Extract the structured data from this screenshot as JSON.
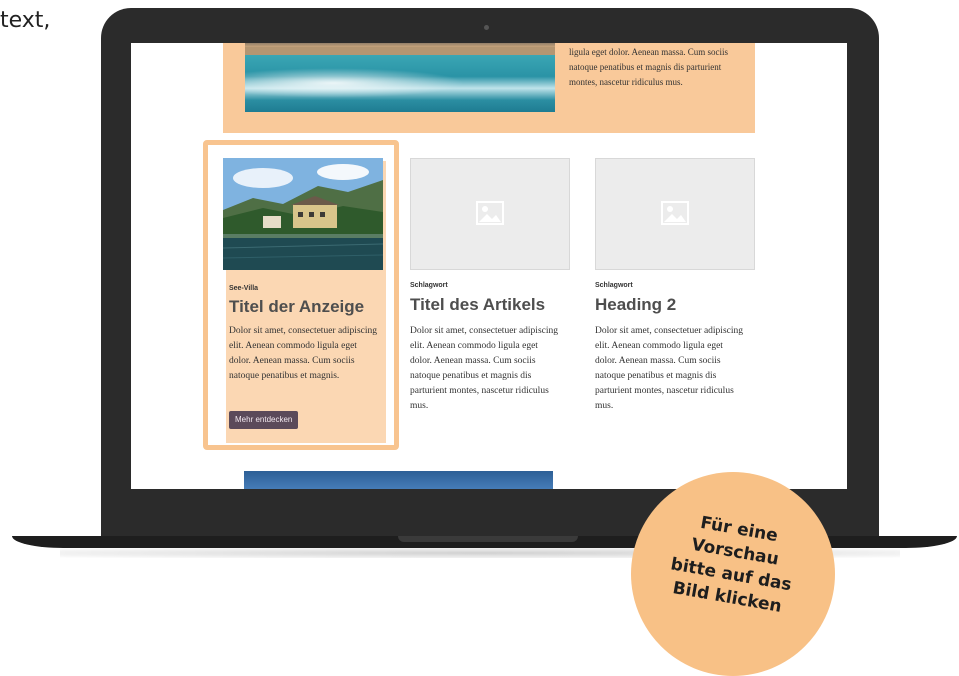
{
  "corner_text": "text,",
  "feature": {
    "text": "ligula eget dolor. Aenean massa. Cum sociis natoque penatibus et magnis dis parturient montes, nascetur ridiculus mus."
  },
  "cards": [
    {
      "tag": "See-Villa",
      "title": "Titel der Anzeige",
      "body": "Dolor sit amet, consectetuer adipiscing elit. Aenean commodo ligula eget dolor. Aenean massa. Cum sociis natoque penatibus et magnis.",
      "button": "Mehr entdecken"
    },
    {
      "tag": "Schlagwort",
      "title": "Titel des Artikels",
      "body": "Dolor sit amet, consectetuer adipiscing elit. Aenean commodo ligula eget dolor. Aenean massa. Cum sociis natoque penatibus et magnis dis parturient montes, nascetur ridiculus mus."
    },
    {
      "tag": "Schlagwort",
      "title": "Heading 2",
      "body": "Dolor sit amet, consectetuer adipiscing elit. Aenean commodo ligula eget dolor. Aenean massa. Cum sociis natoque penatibus et magnis dis parturient montes, nascetur ridiculus mus."
    }
  ],
  "badge": {
    "lines": [
      "Für eine",
      "Vorschau",
      "bitte auf das",
      "Bild klicken"
    ]
  },
  "colors": {
    "accent_peach": "#f8c186",
    "card_bg": "#fbd7b3",
    "button_bg": "#5b4a5a",
    "laptop_frame": "#2b2b2b"
  },
  "icons": [
    "image-placeholder-icon"
  ]
}
